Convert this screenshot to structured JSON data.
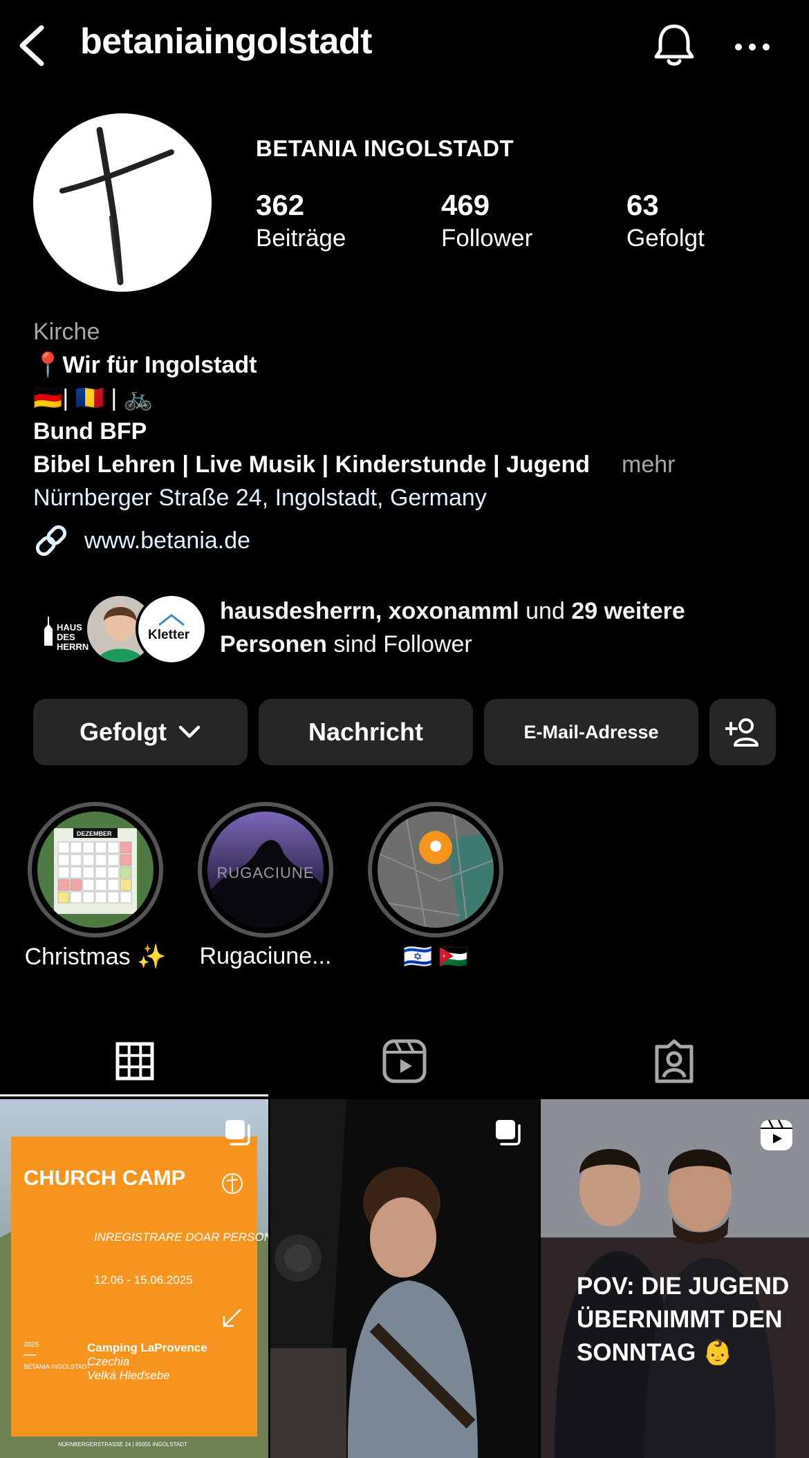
{
  "header": {
    "username": "betaniaingolstadt",
    "back_icon": "chevron-left-icon",
    "bell_icon": "bell-icon",
    "more_icon": "ellipsis-icon"
  },
  "profile": {
    "display_name": "BETANIA INGOLSTADT",
    "stats": [
      {
        "value": "362",
        "label": "Beiträge"
      },
      {
        "value": "469",
        "label": "Follower"
      },
      {
        "value": "63",
        "label": "Gefolgt"
      }
    ]
  },
  "bio": {
    "category": "Kirche",
    "line1": "📍Wir für Ingolstadt",
    "line2": "🇩🇪| 🇷🇴 | 🚲",
    "line3": "Bund BFP",
    "line4": "Bibel Lehren | Live Musik | Kinderstunde | Jugend",
    "more": "mehr",
    "address": "Nürnberger Straße 24, Ingolstadt, Germany",
    "website": "www.betania.de"
  },
  "followed_by": {
    "names": "hausdesherrn, xoxonamml",
    "connector": " und ",
    "count_text": "29 weitere Personen",
    "suffix": " sind Follower",
    "avatar_labels": [
      "HAUS DES HERRN",
      "Kletter"
    ]
  },
  "actions": {
    "follow": "Gefolgt",
    "message": "Nachricht",
    "email": "E-Mail-Adresse"
  },
  "highlights": [
    {
      "label": "Christmas ✨",
      "badge_text": "DEZEMBER"
    },
    {
      "label": "Rugaciune...",
      "cover_text": "RUGACIUNE"
    },
    {
      "label": "🇮🇱 🇯🇴"
    }
  ],
  "tabs": [
    "grid-icon",
    "reels-icon",
    "tagged-icon"
  ],
  "posts": [
    {
      "title": "CHURCH CAMP",
      "subtitle": "INREGISTRARE DOAR PERSONAL",
      "dates": "12.06 - 15.06.2025",
      "year": "2025",
      "org": "BETANIA INGOLSTADT",
      "venue": "Camping LaProvence",
      "country": "Czechia",
      "town": "Velká Hleďsebe",
      "footer": "NÜRNBERGERSTRASSE 24 | 85055 INGOLSTADT"
    },
    {
      "type": "carousel"
    },
    {
      "caption": "POV: DIE JUGEND ÜBERNIMMT DEN SONNTAG 👶"
    }
  ],
  "colors": {
    "background": "#000000",
    "button": "#262626",
    "link": "#e0f1ff",
    "muted": "#a8a8a8",
    "orange": "#f7941d"
  }
}
